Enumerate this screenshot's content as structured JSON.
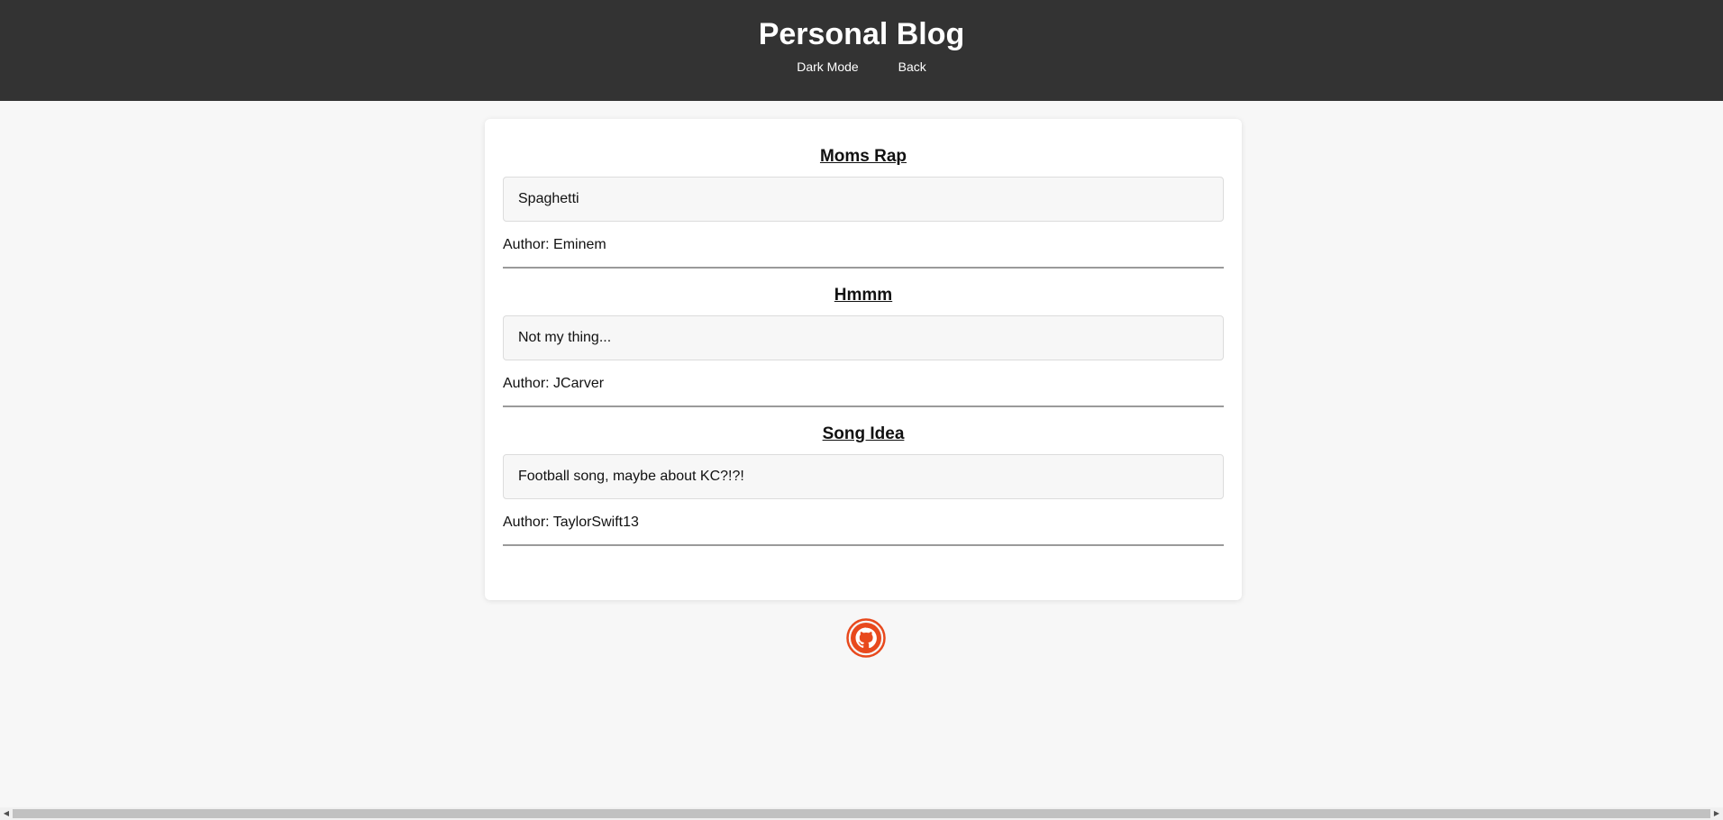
{
  "header": {
    "title": "Personal Blog",
    "nav": [
      {
        "label": "Dark Mode"
      },
      {
        "label": "Back"
      }
    ]
  },
  "posts": [
    {
      "title": "Moms Rap",
      "body": "Spaghetti",
      "author": "Author: Eminem"
    },
    {
      "title": "Hmmm",
      "body": "Not my thing...",
      "author": "Author: JCarver"
    },
    {
      "title": "Song Idea",
      "body": "Football song, maybe about KC?!?!",
      "author": "Author: TaylorSwift13"
    }
  ],
  "footer": {
    "icon": "github-icon",
    "accent_color": "#e8491d"
  },
  "colors": {
    "header_bg": "#333333",
    "page_bg": "#f7f7f7"
  }
}
